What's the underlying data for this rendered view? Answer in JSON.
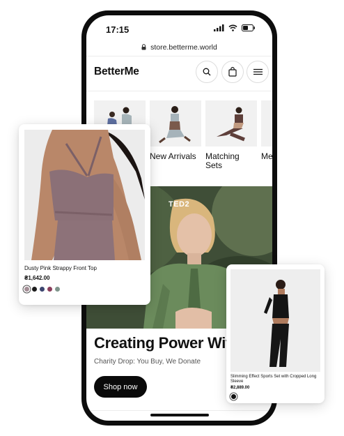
{
  "status": {
    "time": "17:15"
  },
  "browser": {
    "url": "store.betterme.world"
  },
  "header": {
    "brand": "BetterMe"
  },
  "categories": [
    {
      "label": ""
    },
    {
      "label": "New Arrivals"
    },
    {
      "label": "Matching Sets"
    },
    {
      "label": "Me Mo Se"
    }
  ],
  "hero": {
    "tag": "TED2",
    "headline": "Creating Power Wit",
    "subline": "Charity Drop: You Buy, We Donate",
    "cta": "Shop now"
  },
  "product_card_1": {
    "name": "Dusty Pink Strappy Front Top",
    "price": "₴1,642.00",
    "swatches": [
      "#a58f97",
      "#1c1c1c",
      "#3d4670",
      "#8a3f5c",
      "#7f958c"
    ]
  },
  "product_card_2": {
    "name": "Slimming Effect Sports Set with Cropped Long Sleeve",
    "price": "₴2,889.00",
    "swatches": [
      "#111111"
    ]
  },
  "colors": {
    "accent": "#0a0a0a",
    "hero_green": "#56694a"
  }
}
